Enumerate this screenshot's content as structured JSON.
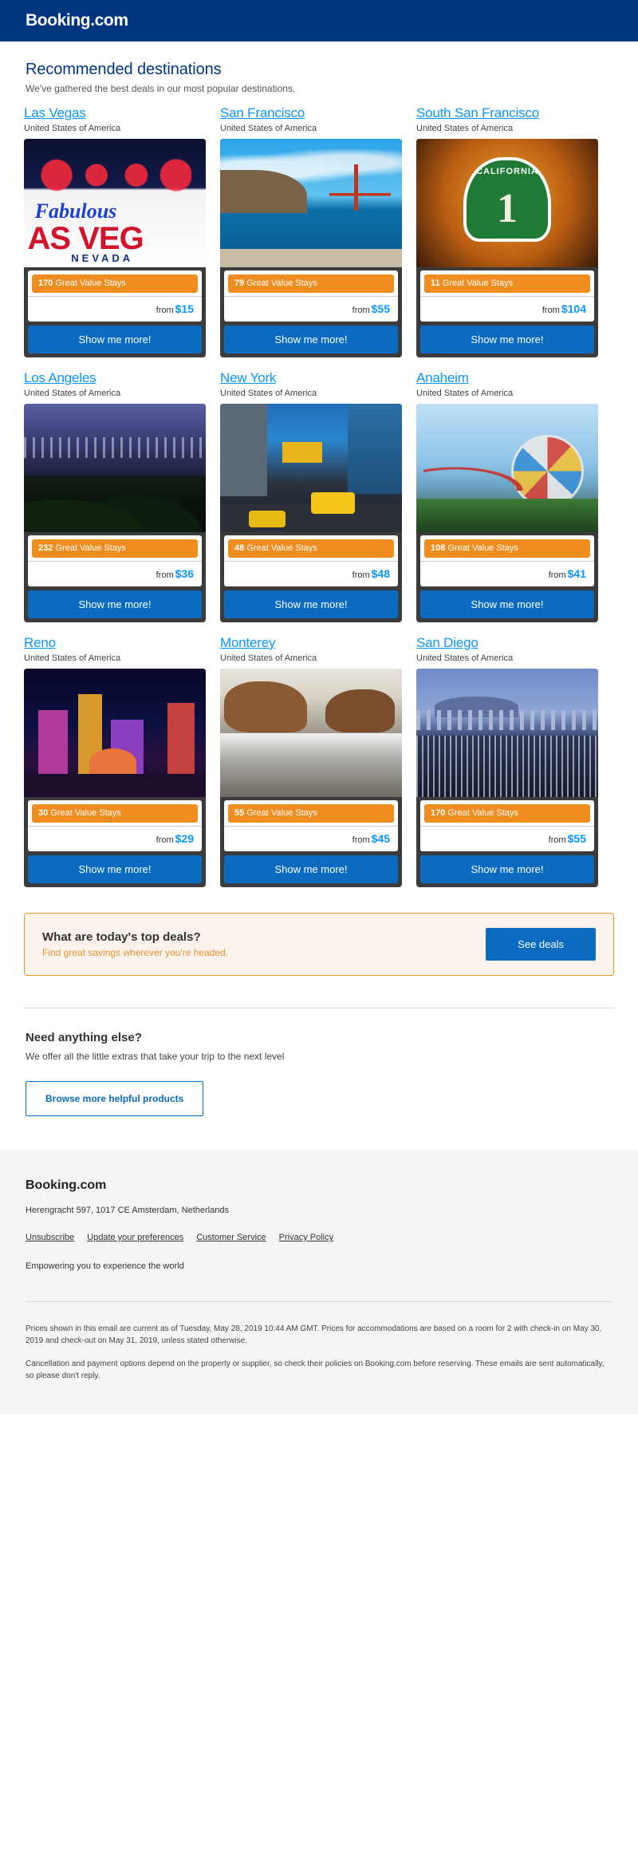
{
  "header": {
    "brand": "Booking.com"
  },
  "intro": {
    "title": "Recommended destinations",
    "subtitle": "We've gathered the best deals in our most popular destinations."
  },
  "labels": {
    "stays_suffix": "Great Value Stays",
    "from": "from",
    "cta": "Show me more!"
  },
  "destinations": [
    {
      "name": "Las Vegas",
      "country": "United States of America",
      "stays": "170",
      "stays_label": "Great Value Stays",
      "from": "from",
      "price": "$15",
      "cta": "Show me more!",
      "photo": "las-vegas-welcome-sign"
    },
    {
      "name": "San Francisco",
      "country": "United States of America",
      "stays": "79",
      "stays_label": "Great Value Stays",
      "from": "from",
      "price": "$55",
      "cta": "Show me more!",
      "photo": "golden-gate-bridge"
    },
    {
      "name": "South San Francisco",
      "country": "United States of America",
      "stays": "11",
      "stays_label": "Great Value Stays",
      "from": "from",
      "price": "$104",
      "cta": "Show me more!",
      "photo": "california-highway-1-sign"
    },
    {
      "name": "Los Angeles",
      "country": "United States of America",
      "stays": "232",
      "stays_label": "Great Value Stays",
      "from": "from",
      "price": "$36",
      "cta": "Show me more!",
      "photo": "los-angeles-night-skyline"
    },
    {
      "name": "New York",
      "country": "United States of America",
      "stays": "48",
      "stays_label": "Great Value Stays",
      "from": "from",
      "price": "$48",
      "cta": "Show me more!",
      "photo": "new-york-times-square-taxis"
    },
    {
      "name": "Anaheim",
      "country": "United States of America",
      "stays": "108",
      "stays_label": "Great Value Stays",
      "from": "from",
      "price": "$41",
      "cta": "Show me more!",
      "photo": "anaheim-theme-park-ferris-wheel"
    },
    {
      "name": "Reno",
      "country": "United States of America",
      "stays": "30",
      "stays_label": "Great Value Stays",
      "from": "from",
      "price": "$29",
      "cta": "Show me more!",
      "photo": "reno-neon-night"
    },
    {
      "name": "Monterey",
      "country": "United States of America",
      "stays": "55",
      "stays_label": "Great Value Stays",
      "from": "from",
      "price": "$45",
      "cta": "Show me more!",
      "photo": "monterey-coastal-rocks"
    },
    {
      "name": "San Diego",
      "country": "United States of America",
      "stays": "170",
      "stays_label": "Great Value Stays",
      "from": "from",
      "price": "$55",
      "cta": "Show me more!",
      "photo": "san-diego-harbor-skyline"
    }
  ],
  "promo": {
    "title": "What are today's top deals?",
    "subtitle": "Find great savings wherever you're headed.",
    "button": "See deals"
  },
  "extras": {
    "title": "Need anything else?",
    "subtitle": "We offer all the little extras that take your trip to the next level",
    "button": "Browse more helpful products"
  },
  "footer": {
    "brand": "Booking.com",
    "address": "Herengracht 597, 1017 CE Amsterdam, Netherlands",
    "links": [
      "Unsubscribe",
      "Update your preferences",
      "Customer Service",
      "Privacy Policy"
    ],
    "tagline": "Empowering you to experience the world",
    "fine_print": [
      "Prices shown in this email are current as of Tuesday, May 28, 2019 10:44 AM GMT. Prices for accommodations are based on a room for 2 with check-in on May 30, 2019 and check-out on May 31, 2019, unless stated otherwise.",
      "Cancellation and payment options depend on the property or supplier, so check their policies on Booking.com before reserving. These emails are sent automatically, so please don't reply."
    ]
  },
  "colors": {
    "brand_blue": "#003580",
    "link_blue": "#0896ff",
    "cta_blue": "#0a6bc0",
    "badge_orange": "#f08d21",
    "promo_border": "#e8922f",
    "promo_bg": "#fbf3ec"
  }
}
